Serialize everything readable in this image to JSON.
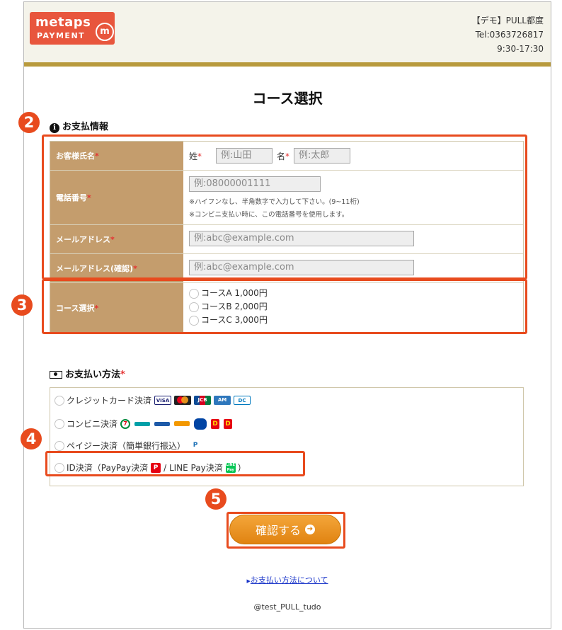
{
  "header": {
    "logo_top": "metaps",
    "logo_bottom": "PAYMENT",
    "logo_mark": "m",
    "company": "【デモ】PULL都度",
    "tel": "Tel:0363726817",
    "hours": "9:30-17:30"
  },
  "page_title": "コース選択",
  "payment_info": {
    "heading": "お支払情報",
    "name_label": "お客様氏名",
    "last_name_label": "姓",
    "last_name_placeholder": "例:山田",
    "first_name_label": "名",
    "first_name_placeholder": "例:太郎",
    "phone_label": "電話番号",
    "phone_placeholder": "例:08000001111",
    "phone_note1": "※ハイフンなし、半角数字で入力して下さい。(9~11桁)",
    "phone_note2": "※コンビニ支払い時に、この電話番号を使用します。",
    "email_label": "メールアドレス",
    "email_placeholder": "例:abc@example.com",
    "email_confirm_label": "メールアドレス(確認)",
    "email_confirm_placeholder": "例:abc@example.com"
  },
  "course": {
    "label": "コース選択",
    "options": [
      "コースA 1,000円",
      "コースB 2,000円",
      "コースC 3,000円"
    ]
  },
  "payment_method": {
    "heading": "お支払い方法",
    "options": {
      "credit": "クレジットカード決済",
      "konbini": "コンビニ決済",
      "payeasy": "ペイジー決済（簡単銀行振込）",
      "id": "ID決済（PayPay決済",
      "id_mid": "/ LINE Pay決済",
      "id_end": "）"
    }
  },
  "required_mark": "*",
  "badges": [
    "2",
    "3",
    "4",
    "5"
  ],
  "confirm_button": "確認する",
  "about_link": "お支払い方法について",
  "footer": "@test_PULL_tudo",
  "colors": {
    "accent": "#e84b1e",
    "label_bg": "#c49d6d",
    "gold_bar": "#b89a3d",
    "button": "#e08311"
  }
}
